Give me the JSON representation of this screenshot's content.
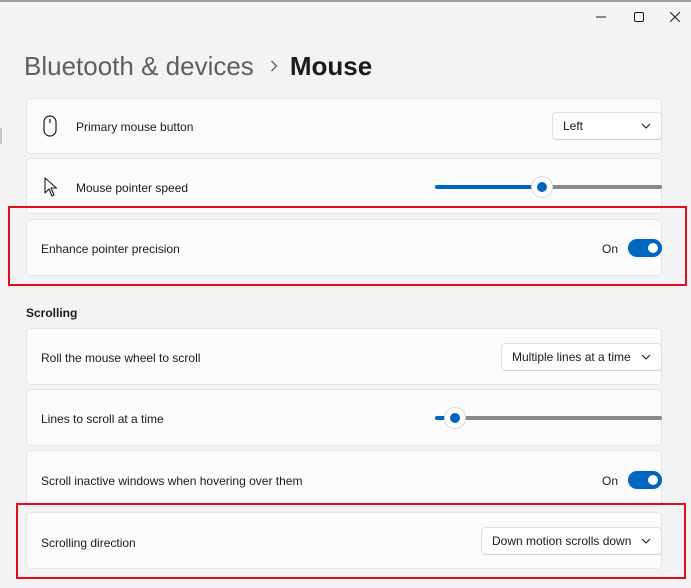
{
  "window": {
    "minimize_icon": "minimize-icon",
    "maximize_icon": "maximize-icon",
    "close_icon": "close-icon"
  },
  "breadcrumb": {
    "parent": "Bluetooth & devices",
    "separator_icon": "chevron-right-icon",
    "current": "Mouse"
  },
  "settings": {
    "primary_button": {
      "label": "Primary mouse button",
      "icon": "mouse-icon",
      "value": "Left"
    },
    "pointer_speed": {
      "label": "Mouse pointer speed",
      "icon": "pointer-icon",
      "level_fraction": 0.47
    },
    "enhance_precision": {
      "label": "Enhance pointer precision",
      "state": "On"
    }
  },
  "scrolling": {
    "title": "Scrolling",
    "roll_wheel": {
      "label": "Roll the mouse wheel to scroll",
      "value": "Multiple lines at a time"
    },
    "lines_to_scroll": {
      "label": "Lines to scroll at a time",
      "level_fraction": 0.05
    },
    "inactive_windows": {
      "label": "Scroll inactive windows when hovering over them",
      "state": "On"
    },
    "direction": {
      "label": "Scrolling direction",
      "value": "Down motion scrolls down"
    }
  },
  "colors": {
    "accent": "#0067c0",
    "highlight": "#e10d1d",
    "background": "#f3f3f3",
    "card": "#fbfbfb"
  }
}
